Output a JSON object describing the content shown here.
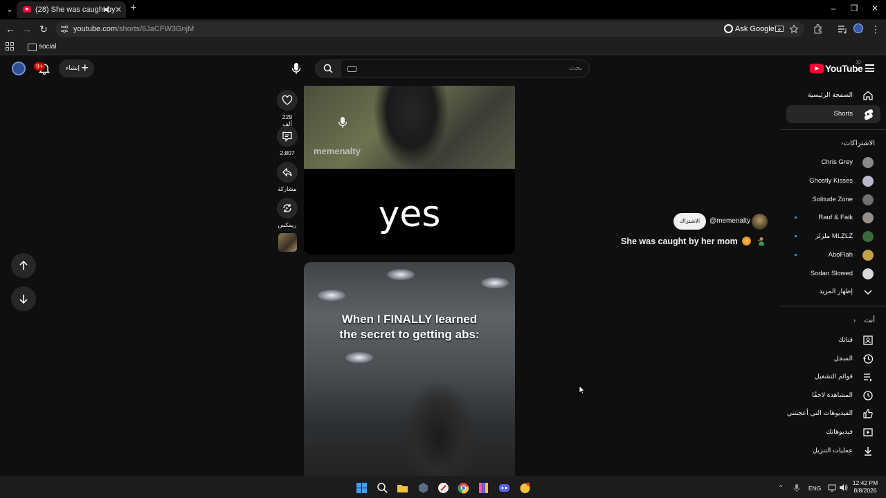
{
  "browser": {
    "tab_title": "(28) She was caught by her",
    "url_host": "youtube.com",
    "url_path": "/shorts/6JaCFW3GnjM",
    "ask_google": "Ask Google",
    "bookmark_folder": "social"
  },
  "masthead": {
    "notification_count": "9+",
    "create_label": "إنشاء",
    "search_placeholder": "بحث",
    "logo_text": "YouTube",
    "logo_country": "JO"
  },
  "sidebar": {
    "home": "الصفحة الرئيسية",
    "shorts": "Shorts",
    "subscriptions_header": "الاشتراكات",
    "channels": [
      {
        "name": "Chris Grey",
        "dot": false
      },
      {
        "name": "Ghostly Kisses",
        "dot": false
      },
      {
        "name": "Solitude Zone",
        "dot": false
      },
      {
        "name": "Rauf & Faik",
        "dot": true
      },
      {
        "name": "ملزلز MLZLZ",
        "dot": true
      },
      {
        "name": "AboFlah",
        "dot": true
      },
      {
        "name": "Sodan Slowed",
        "dot": false
      }
    ],
    "show_more": "إظهار المزيد",
    "you_header": "أنت",
    "you_items": [
      "قناتك",
      "السجل",
      "قوائم التشغيل",
      "المشاهدة لاحقًا",
      "الفيديوهات التي أعجبتني",
      "فيديوهاتك",
      "عمليات التنزيل"
    ]
  },
  "short": {
    "watermark": "memenalty",
    "overlay_text": "yes",
    "next_caption_line1": "When I FINALLY learned",
    "next_caption_line2": "the secret to getting abs:",
    "likes": "229 ألف",
    "comments": "2,807",
    "share": "مشاركة",
    "remix": "ريمكس",
    "channel_handle": "@memenalty",
    "subscribe": "الاشتراك",
    "title": "She was caught by her mom"
  },
  "taskbar": {
    "lang": "ENG",
    "time": "12:42 PM",
    "date": "8/8/2026"
  },
  "colors": {
    "youtube_red": "#ff0033",
    "background": "#0f0f0f",
    "surface": "#272727",
    "unread_dot": "#3ea6ff"
  }
}
